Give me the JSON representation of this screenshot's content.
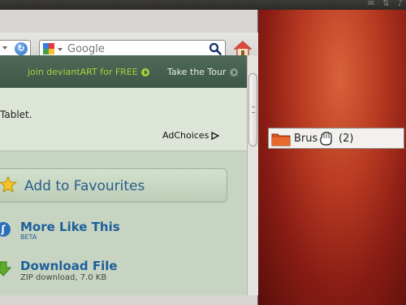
{
  "browser": {
    "search": {
      "placeholder": "Google"
    }
  },
  "page": {
    "promo_bar": {
      "join_label": "join deviantART for FREE",
      "tour_label": "Take the Tour"
    },
    "ad": {
      "tablet_text": "Tablet.",
      "adchoices_label": "AdChoices"
    },
    "actions": {
      "favourite_label": "Add to Favourites",
      "more_like_title": "More Like This",
      "more_like_badge": "BETA",
      "download_title": "Download File",
      "download_info": "ZIP download, 7.0 KB"
    }
  },
  "drag": {
    "folder_name": "Brus",
    "count": "(2)"
  },
  "colors": {
    "link_blue": "#1d5f9a",
    "promo_green": "#a9cf3c",
    "page_bg": "#c7d4c2"
  }
}
